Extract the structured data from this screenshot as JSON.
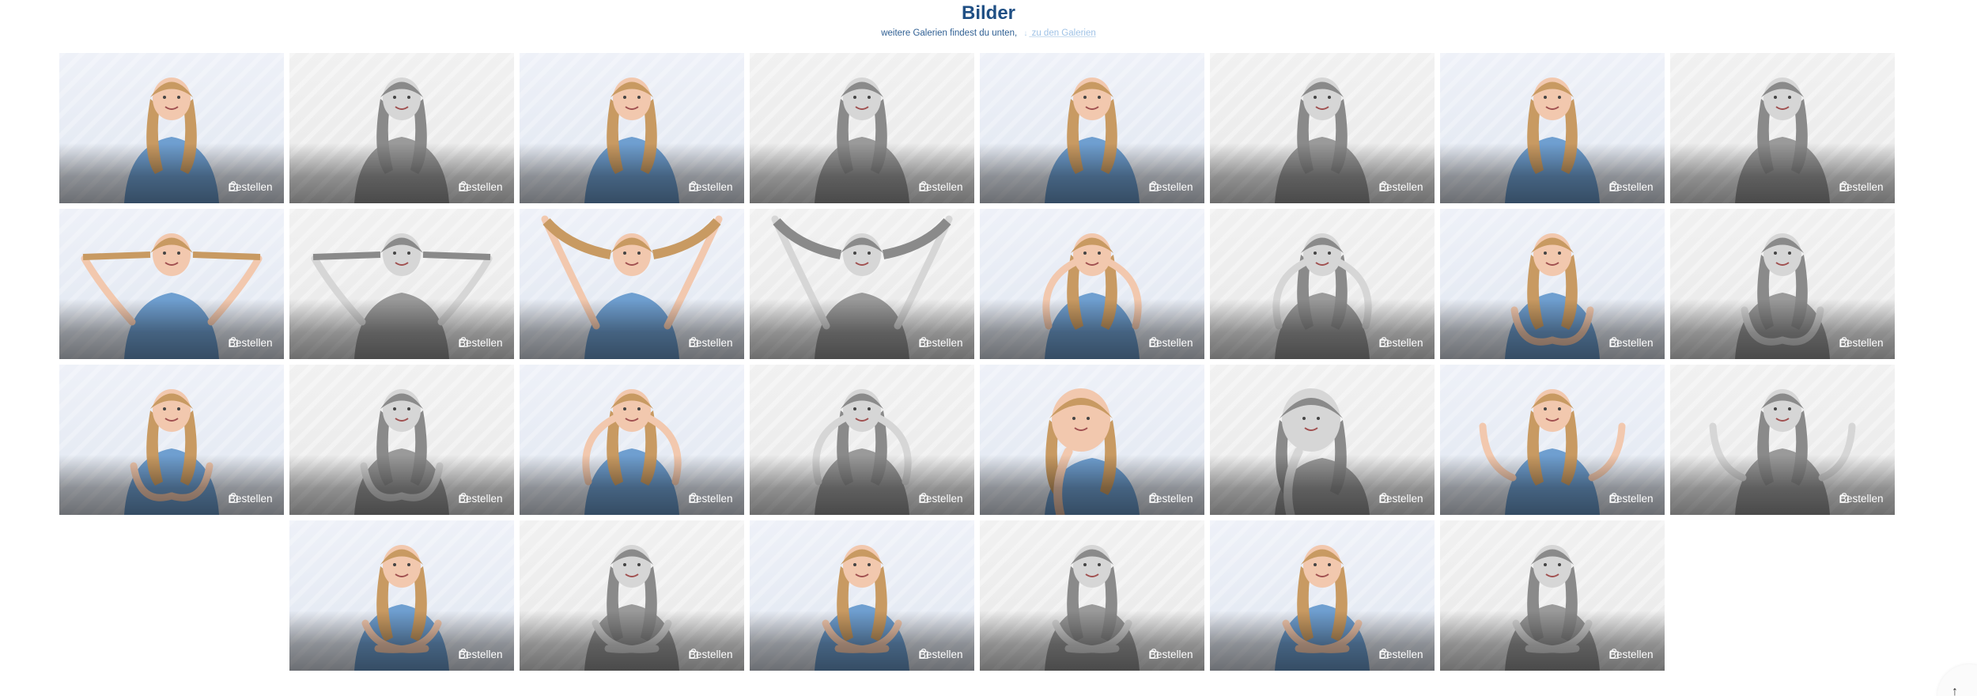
{
  "header": {
    "title": "Bilder",
    "subtitle": "weitere Galerien findest du unten,",
    "link_icon": "arrow-down-icon",
    "link_label": "zu den Galerien"
  },
  "gallery": {
    "order_label": "Bestellen",
    "order_icon": "shopping-bag-icon",
    "rows": [
      {
        "tiles": [
          {
            "style": "color",
            "pose": "portrait"
          },
          {
            "style": "bw",
            "pose": "portrait"
          },
          {
            "style": "color",
            "pose": "portrait"
          },
          {
            "style": "bw",
            "pose": "portrait"
          },
          {
            "style": "color",
            "pose": "portrait"
          },
          {
            "style": "bw",
            "pose": "portrait"
          },
          {
            "style": "color",
            "pose": "portrait"
          },
          {
            "style": "bw",
            "pose": "portrait"
          }
        ]
      },
      {
        "tiles": [
          {
            "style": "color",
            "pose": "pigtails-out"
          },
          {
            "style": "bw",
            "pose": "pigtails-out"
          },
          {
            "style": "color",
            "pose": "pigtails-up"
          },
          {
            "style": "bw",
            "pose": "pigtails-up"
          },
          {
            "style": "color",
            "pose": "funny-face"
          },
          {
            "style": "bw",
            "pose": "funny-face"
          },
          {
            "style": "color",
            "pose": "heart-hands"
          },
          {
            "style": "bw",
            "pose": "heart-hands"
          }
        ]
      },
      {
        "tiles": [
          {
            "style": "color",
            "pose": "heart-hands"
          },
          {
            "style": "bw",
            "pose": "heart-hands"
          },
          {
            "style": "color",
            "pose": "hands-face"
          },
          {
            "style": "bw",
            "pose": "hands-face"
          },
          {
            "style": "color",
            "pose": "closeup"
          },
          {
            "style": "bw",
            "pose": "closeup"
          },
          {
            "style": "color",
            "pose": "peace"
          },
          {
            "style": "bw",
            "pose": "peace"
          }
        ]
      },
      {
        "tiles": [
          {
            "style": "color",
            "pose": "arms-crossed"
          },
          {
            "style": "bw",
            "pose": "arms-crossed"
          },
          {
            "style": "color",
            "pose": "arms-crossed"
          },
          {
            "style": "bw",
            "pose": "arms-crossed"
          },
          {
            "style": "color",
            "pose": "arms-crossed"
          },
          {
            "style": "bw",
            "pose": "arms-crossed"
          }
        ]
      }
    ]
  },
  "scroll_top": {
    "icon": "arrow-up-icon",
    "glyph": "↑"
  },
  "colors": {
    "title": "#1f4f84",
    "link": "#9fc2e6",
    "hair_color": "#c89a62",
    "dress_color": "#6f9fd0",
    "skin_color": "#f2c8ae",
    "hair_bw": "#8a8a8a",
    "dress_bw": "#9a9a9a",
    "skin_bw": "#d6d6d6"
  }
}
